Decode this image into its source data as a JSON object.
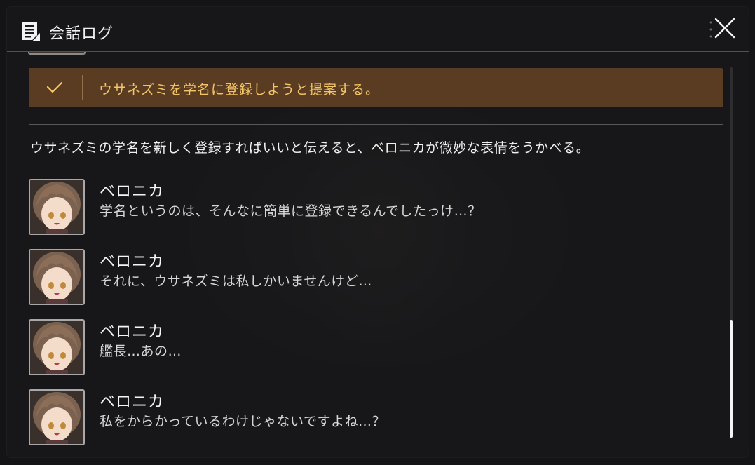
{
  "header": {
    "title": "会話ログ",
    "icon": "log-icon",
    "close_icon": "close-icon"
  },
  "choice": {
    "text": "ウサネズミを学名に登録しようと提案する。",
    "icon": "check-icon",
    "bg_color": "#5a3c22",
    "text_color": "#f3c56a"
  },
  "narration": "ウサネズミの学名を新しく登録すればいいと伝えると、ベロニカが微妙な表情をうかべる。",
  "messages": [
    {
      "speaker": "ベロニカ",
      "text": "学名というのは、そんなに簡単に登録できるんでしたっけ…？"
    },
    {
      "speaker": "ベロニカ",
      "text": "それに、ウサネズミは私しかいませんけど…"
    },
    {
      "speaker": "ベロニカ",
      "text": "艦長…あの…"
    },
    {
      "speaker": "ベロニカ",
      "text": "私をからかっているわけじゃないですよね…？"
    }
  ]
}
